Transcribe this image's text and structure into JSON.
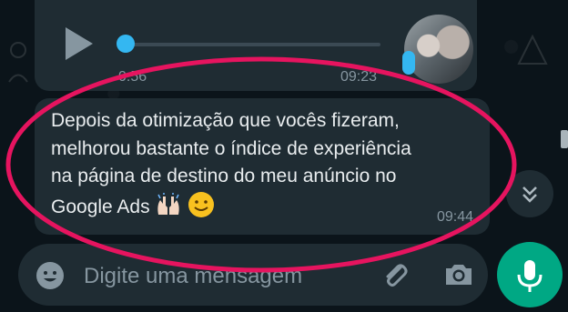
{
  "audio_message": {
    "duration": "0:56",
    "time": "09:23",
    "progress": 0.0
  },
  "text_message": {
    "lines": [
      "Depois da otimização que vocês fizeram,",
      "melhorou bastante o índice de experiência",
      "na página de destino do meu anúncio no",
      "Google Ads"
    ],
    "emojis": [
      "raising-hands-emoji",
      "smiling-face-emoji"
    ],
    "time": "09:44"
  },
  "composer": {
    "placeholder": "Digite uma mensagem"
  },
  "colors": {
    "bubble": "#1f2c33",
    "accent_green": "#00a884",
    "accent_blue": "#34b7f1",
    "highlight": "#e6145f"
  }
}
